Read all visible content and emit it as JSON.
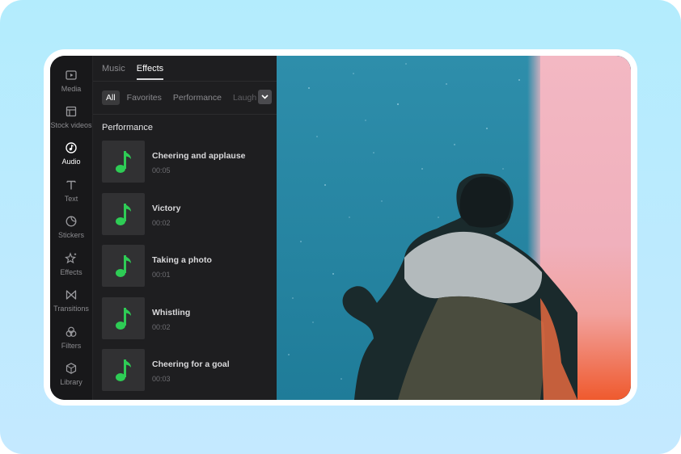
{
  "sidebar": {
    "items": [
      {
        "label": "Media",
        "icon": "media-icon"
      },
      {
        "label": "Stock videos",
        "icon": "stock-videos-icon"
      },
      {
        "label": "Audio",
        "icon": "audio-icon",
        "active": true
      },
      {
        "label": "Text",
        "icon": "text-icon"
      },
      {
        "label": "Stickers",
        "icon": "stickers-icon"
      },
      {
        "label": "Effects",
        "icon": "effects-icon"
      },
      {
        "label": "Transitions",
        "icon": "transitions-icon"
      },
      {
        "label": "Filters",
        "icon": "filters-icon"
      },
      {
        "label": "Library",
        "icon": "library-icon"
      }
    ]
  },
  "panel": {
    "tabs": [
      {
        "label": "Music"
      },
      {
        "label": "Effects",
        "active": true
      }
    ],
    "filters": [
      {
        "label": "All",
        "active": true
      },
      {
        "label": "Favorites"
      },
      {
        "label": "Performance"
      },
      {
        "label": "Laugh"
      }
    ],
    "section_title": "Performance",
    "sounds": [
      {
        "name": "Cheering and applause",
        "duration": "00:05"
      },
      {
        "name": "Victory",
        "duration": "00:02"
      },
      {
        "name": "Taking a photo",
        "duration": "00:01"
      },
      {
        "name": "Whistling",
        "duration": "00:02"
      },
      {
        "name": "Cheering for a goal",
        "duration": "00:03"
      }
    ]
  },
  "colors": {
    "accent_note": "#2ecc55",
    "rail_bg": "#18181a",
    "panel_bg": "#1e1e20",
    "page_bg": "#b3ecfd"
  }
}
